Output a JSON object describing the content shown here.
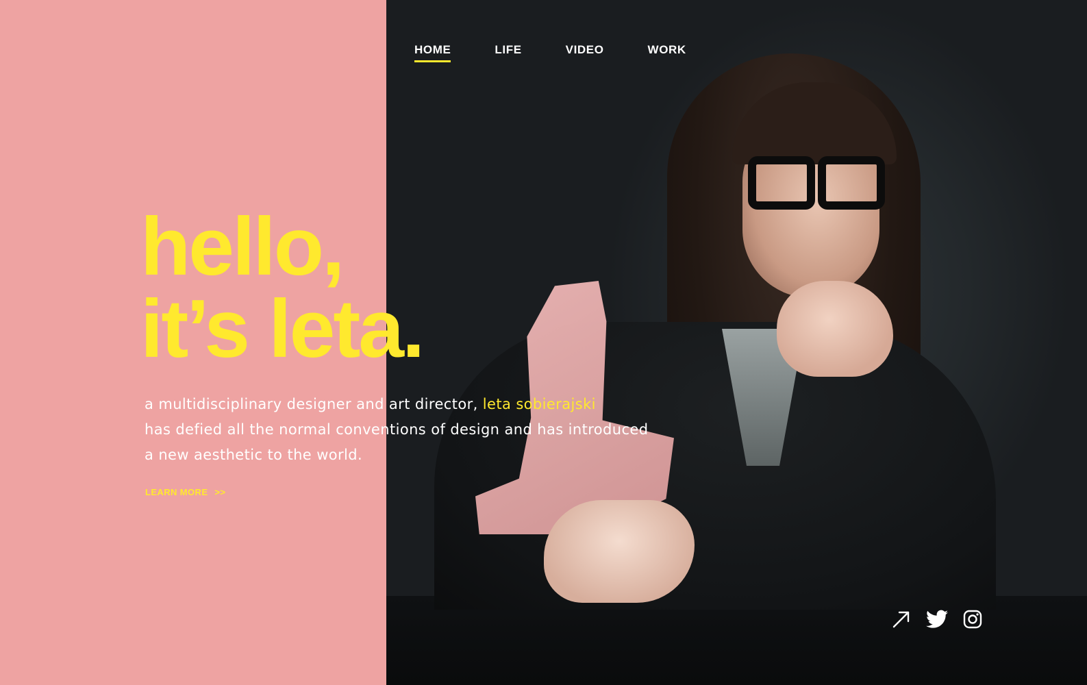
{
  "nav": {
    "items": [
      {
        "label": "HOME",
        "active": true
      },
      {
        "label": "LIFE",
        "active": false
      },
      {
        "label": "VIDEO",
        "active": false
      },
      {
        "label": "WORK",
        "active": false
      }
    ]
  },
  "hero": {
    "line1": "hello,",
    "line2": "it’s leta."
  },
  "intro": {
    "line1_prefix": "a multidisciplinary designer and art director,",
    "line1_name": "leta sobierajski",
    "line2": "has defied all the normal conventions of design and has introduced",
    "line3": "a new aesthetic to the world."
  },
  "cta": {
    "label": "LEARN MORE",
    "arrows": ">>"
  },
  "social": {
    "items": [
      {
        "icon": "external-link-arrow-icon"
      },
      {
        "icon": "twitter-icon"
      },
      {
        "icon": "instagram-icon"
      }
    ]
  },
  "colors": {
    "panel": "#eea3a2",
    "accent": "#ffe92e",
    "background": "#1c1f22",
    "text": "#ffffff"
  }
}
